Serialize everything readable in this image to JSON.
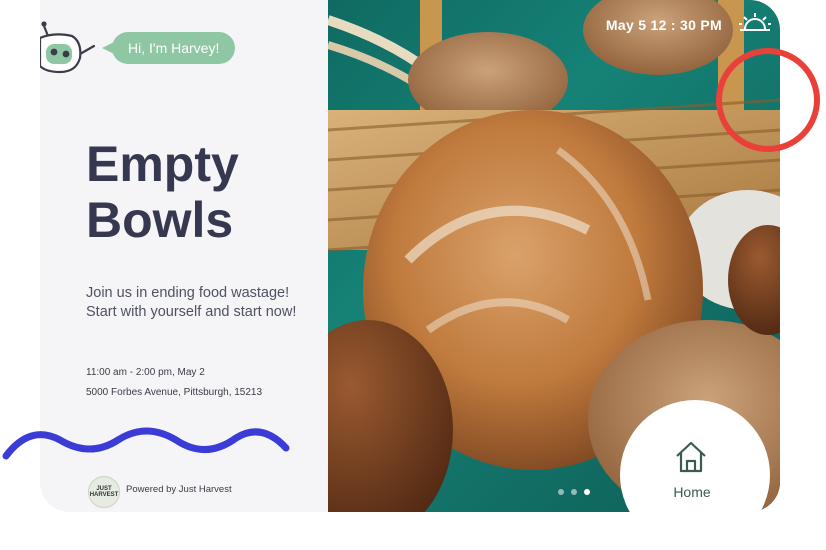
{
  "assistant": {
    "greeting": "Hi, I'm Harvey!"
  },
  "event": {
    "title_line1": "Empty",
    "title_line2": "Bowls",
    "description_line1": "Join us in ending food wastage!",
    "description_line2": "Start with yourself and start now!",
    "time": "11:00 am - 2:00 pm, May 2",
    "address": "5000 Forbes Avenue, Pittsburgh, 15213"
  },
  "footer": {
    "logo_text_line1": "JUST",
    "logo_text_line2": "HARVEST",
    "powered_by": "Powered by Just Harvest"
  },
  "status_bar": {
    "datetime": "May 5   12 : 30 PM",
    "weather_icon": "sunrise-icon"
  },
  "carousel": {
    "page_count": 3,
    "active_index": 2
  },
  "nav": {
    "home_label": "Home",
    "home_icon": "home-icon"
  },
  "annotations": {
    "circle_color": "#e9413a",
    "squiggle_color": "#3b3bd6"
  },
  "theme": {
    "accent": "#8fc7a4",
    "title_color": "#363850"
  }
}
